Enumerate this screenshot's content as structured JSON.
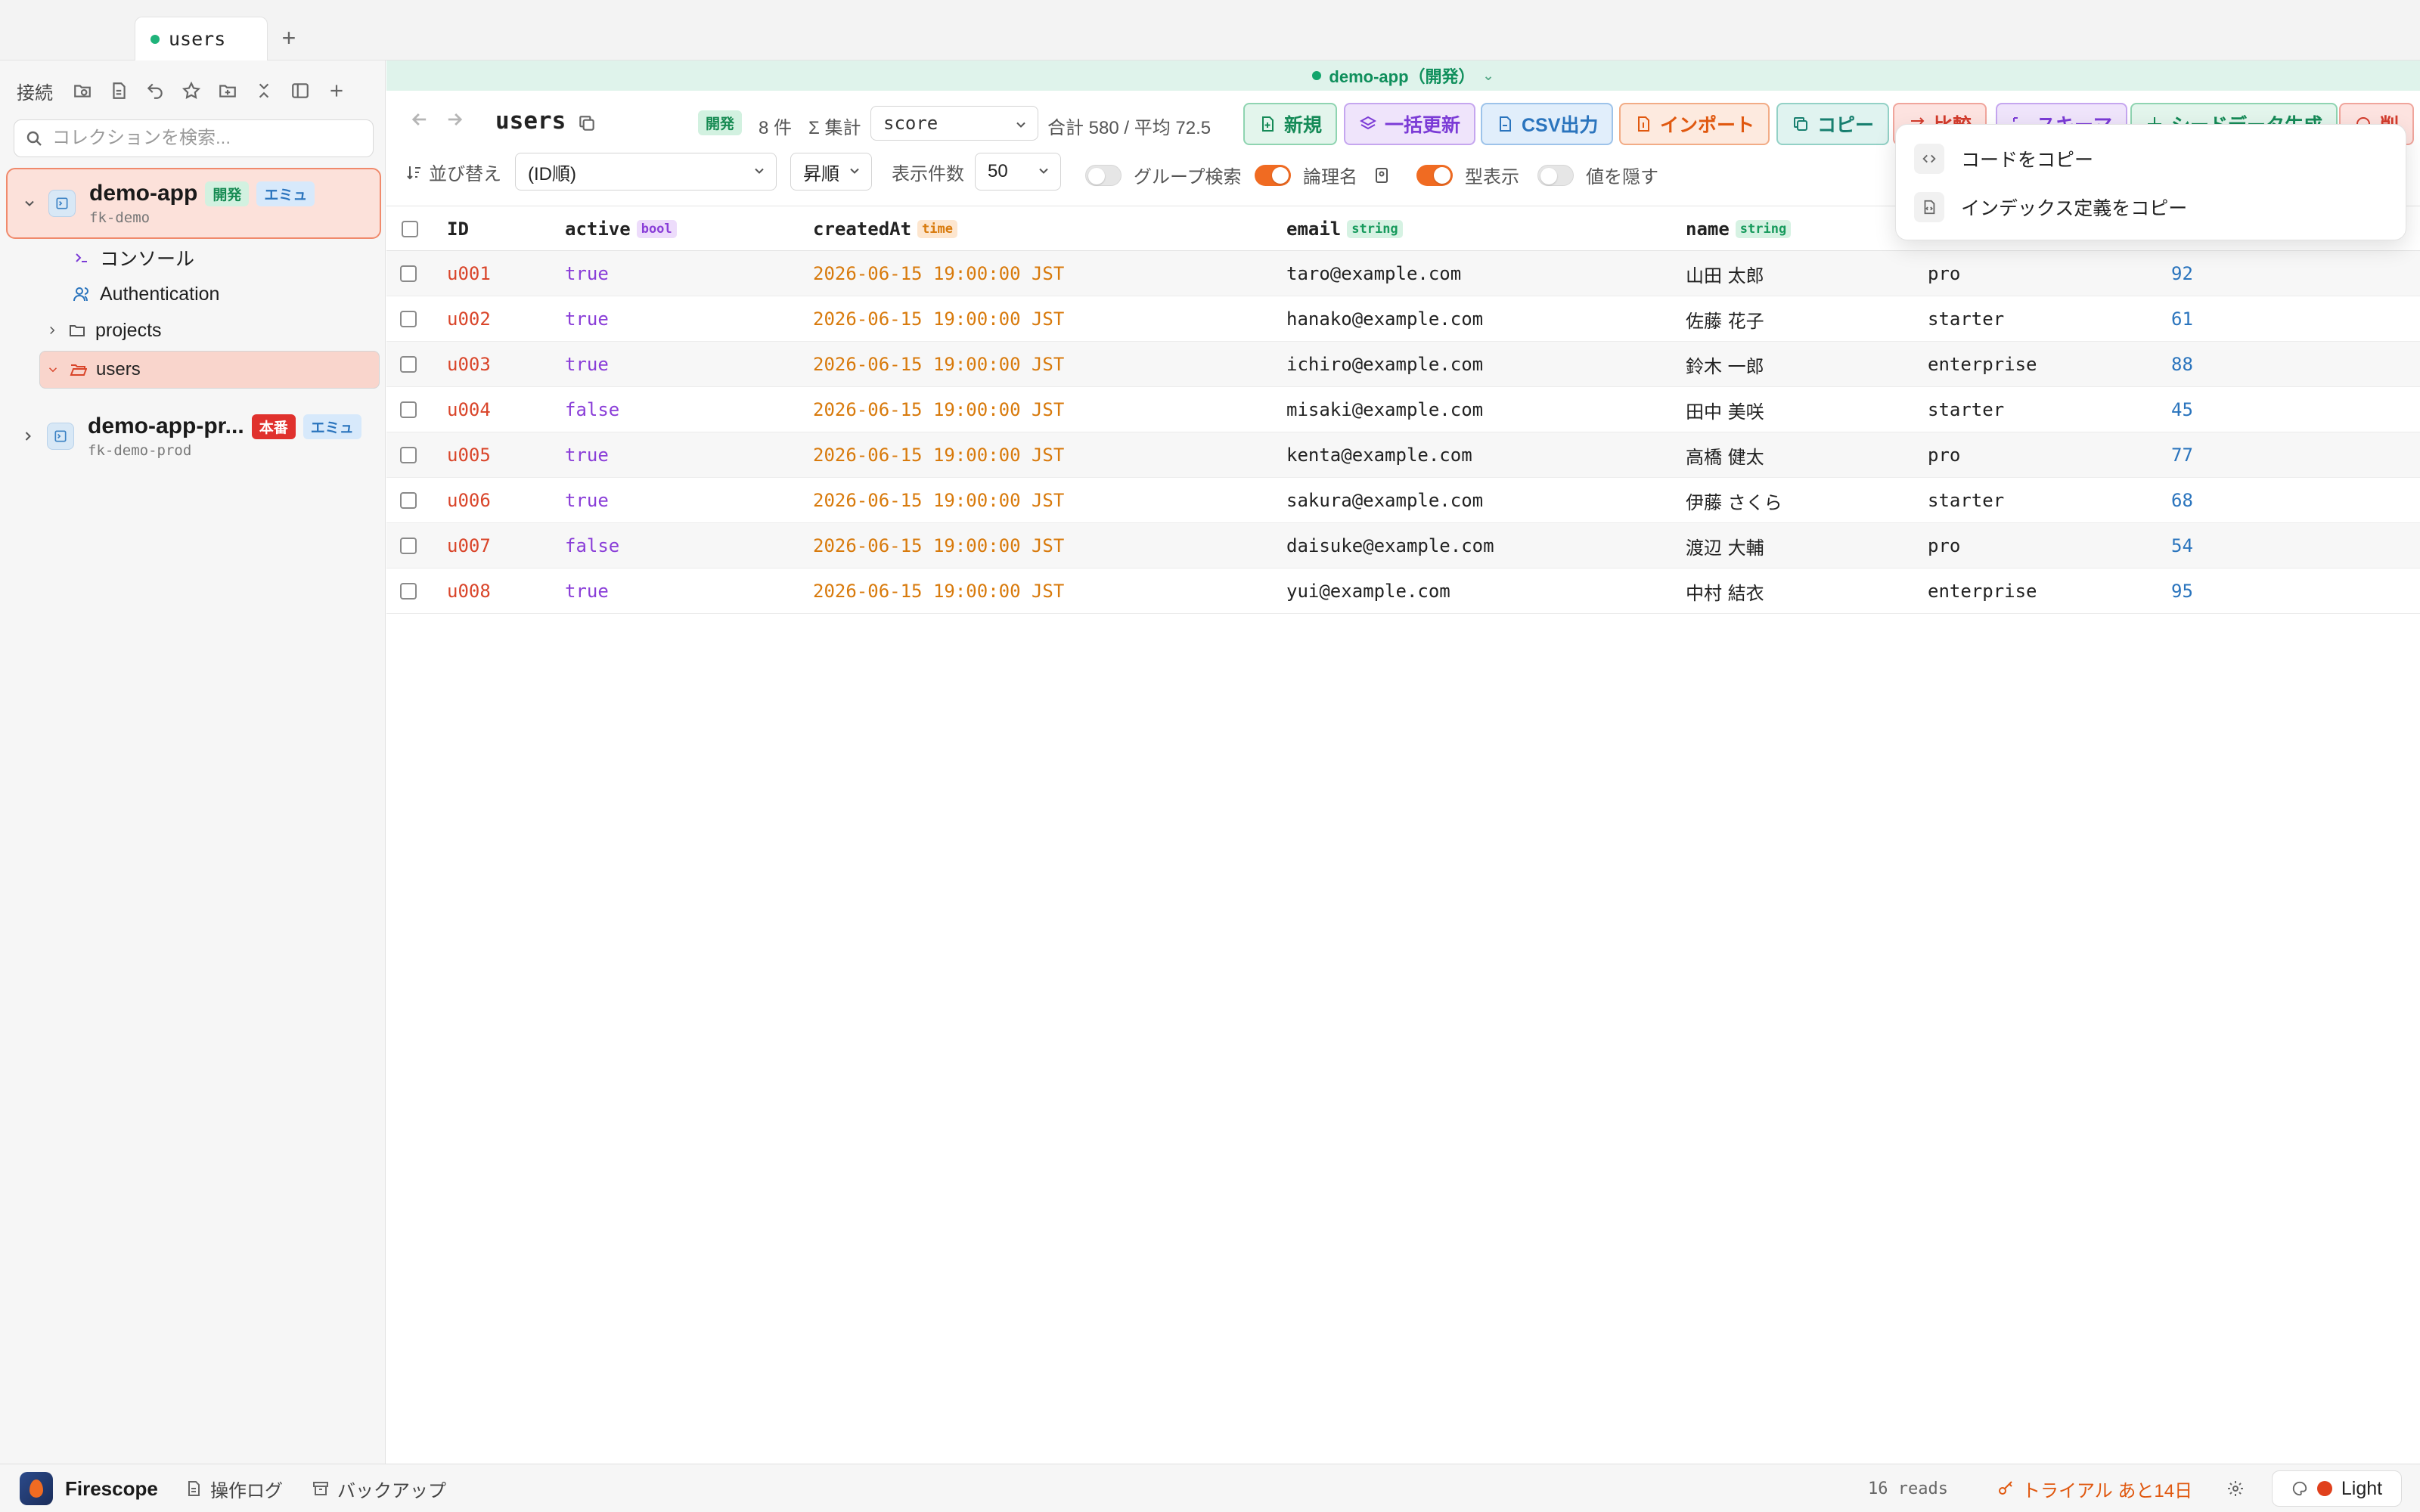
{
  "tab": {
    "label": "users",
    "add": "+"
  },
  "sidebar": {
    "title": "接続",
    "search_placeholder": "コレクションを検索...",
    "connections": [
      {
        "name": "demo-app",
        "project": "fk-demo",
        "env_badge": "開発",
        "emu_badge": "エミュ",
        "expanded": true
      },
      {
        "name": "demo-app-pr...",
        "project": "fk-demo-prod",
        "env_badge": "本番",
        "emu_badge": "エミュ",
        "expanded": false
      }
    ],
    "tree": [
      {
        "label": "コンソール",
        "icon": "terminal-icon"
      },
      {
        "label": "Authentication",
        "icon": "users-icon"
      },
      {
        "label": "projects",
        "icon": "folder-icon"
      },
      {
        "label": "users",
        "icon": "folder-open-icon"
      }
    ]
  },
  "envbar": {
    "label": "demo-app（開発）"
  },
  "toolbar": {
    "collection": "users",
    "env_badge": "開発",
    "count": "8 件",
    "aggregate_label": "Σ 集計",
    "aggregate_field": "score",
    "aggregate_result": "合計 580 / 平均 72.5",
    "buttons": {
      "new": "新規",
      "bulk_update": "一括更新",
      "csv_export": "CSV出力",
      "import": "インポート",
      "copy": "コピー",
      "compare": "比較",
      "schema": "スキーマ",
      "seed": "シードデータ生成",
      "delete": "削"
    }
  },
  "filters": {
    "sort_label": "並び替え",
    "sort_value": "(ID順)",
    "order_value": "昇順",
    "limit_label": "表示件数",
    "limit_value": "50",
    "group_search": "グループ検索",
    "logical_name": "論理名",
    "type_display": "型表示",
    "hide_values": "値を隠す"
  },
  "table": {
    "columns": [
      {
        "name": "ID",
        "type": ""
      },
      {
        "name": "active",
        "type": "bool"
      },
      {
        "name": "createdAt",
        "type": "time"
      },
      {
        "name": "email",
        "type": "string"
      },
      {
        "name": "name",
        "type": "string"
      }
    ],
    "rows": [
      {
        "id": "u001",
        "active": "true",
        "createdAt": "2026-06-15 19:00:00 JST",
        "email": "taro@example.com",
        "name": "山田 太郎",
        "plan": "pro",
        "score": "92"
      },
      {
        "id": "u002",
        "active": "true",
        "createdAt": "2026-06-15 19:00:00 JST",
        "email": "hanako@example.com",
        "name": "佐藤 花子",
        "plan": "starter",
        "score": "61"
      },
      {
        "id": "u003",
        "active": "true",
        "createdAt": "2026-06-15 19:00:00 JST",
        "email": "ichiro@example.com",
        "name": "鈴木 一郎",
        "plan": "enterprise",
        "score": "88"
      },
      {
        "id": "u004",
        "active": "false",
        "createdAt": "2026-06-15 19:00:00 JST",
        "email": "misaki@example.com",
        "name": "田中 美咲",
        "plan": "starter",
        "score": "45"
      },
      {
        "id": "u005",
        "active": "true",
        "createdAt": "2026-06-15 19:00:00 JST",
        "email": "kenta@example.com",
        "name": "高橋 健太",
        "plan": "pro",
        "score": "77"
      },
      {
        "id": "u006",
        "active": "true",
        "createdAt": "2026-06-15 19:00:00 JST",
        "email": "sakura@example.com",
        "name": "伊藤 さくら",
        "plan": "starter",
        "score": "68"
      },
      {
        "id": "u007",
        "active": "false",
        "createdAt": "2026-06-15 19:00:00 JST",
        "email": "daisuke@example.com",
        "name": "渡辺 大輔",
        "plan": "pro",
        "score": "54"
      },
      {
        "id": "u008",
        "active": "true",
        "createdAt": "2026-06-15 19:00:00 JST",
        "email": "yui@example.com",
        "name": "中村 結衣",
        "plan": "enterprise",
        "score": "95"
      }
    ]
  },
  "popup": {
    "items": [
      {
        "label": "コードをコピー",
        "icon": "code-icon"
      },
      {
        "label": "インデックス定義をコピー",
        "icon": "file-code-icon"
      }
    ]
  },
  "statusbar": {
    "app_name": "Firescope",
    "op_log": "操作ログ",
    "backup": "バックアップ",
    "reads": "16 reads",
    "trial": "トライアル あと14日",
    "theme": "Light"
  }
}
